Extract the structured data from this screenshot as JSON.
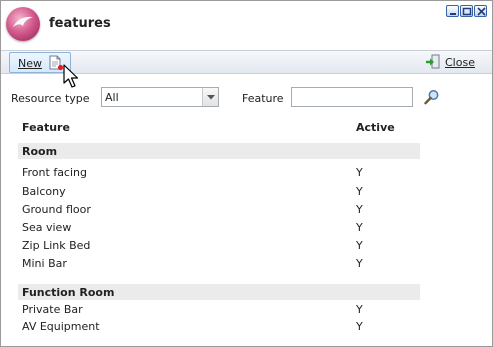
{
  "window": {
    "title": "features"
  },
  "toolbar": {
    "new_label": "New",
    "close_label": "Close"
  },
  "filter": {
    "resource_type_label": "Resource type",
    "resource_type_value": "All",
    "feature_label": "Feature",
    "feature_value": ""
  },
  "table": {
    "headers": {
      "feature": "Feature",
      "active": "Active"
    },
    "groups": [
      {
        "name": "Room",
        "rows": [
          {
            "feature": "Front facing",
            "active": "Y"
          },
          {
            "feature": "Balcony",
            "active": "Y"
          },
          {
            "feature": "Ground floor",
            "active": "Y"
          },
          {
            "feature": "Sea view",
            "active": "Y"
          },
          {
            "feature": "Zip Link Bed",
            "active": "Y"
          },
          {
            "feature": "Mini Bar",
            "active": "Y"
          }
        ]
      },
      {
        "name": "Function Room",
        "rows": [
          {
            "feature": "Private Bar",
            "active": "Y"
          },
          {
            "feature": "AV Equipment",
            "active": "Y"
          }
        ]
      }
    ]
  },
  "colors": {
    "accent": "#d45b8e",
    "toolbar_bg": "#e3e8ef",
    "group_bg": "#ebebeb"
  }
}
